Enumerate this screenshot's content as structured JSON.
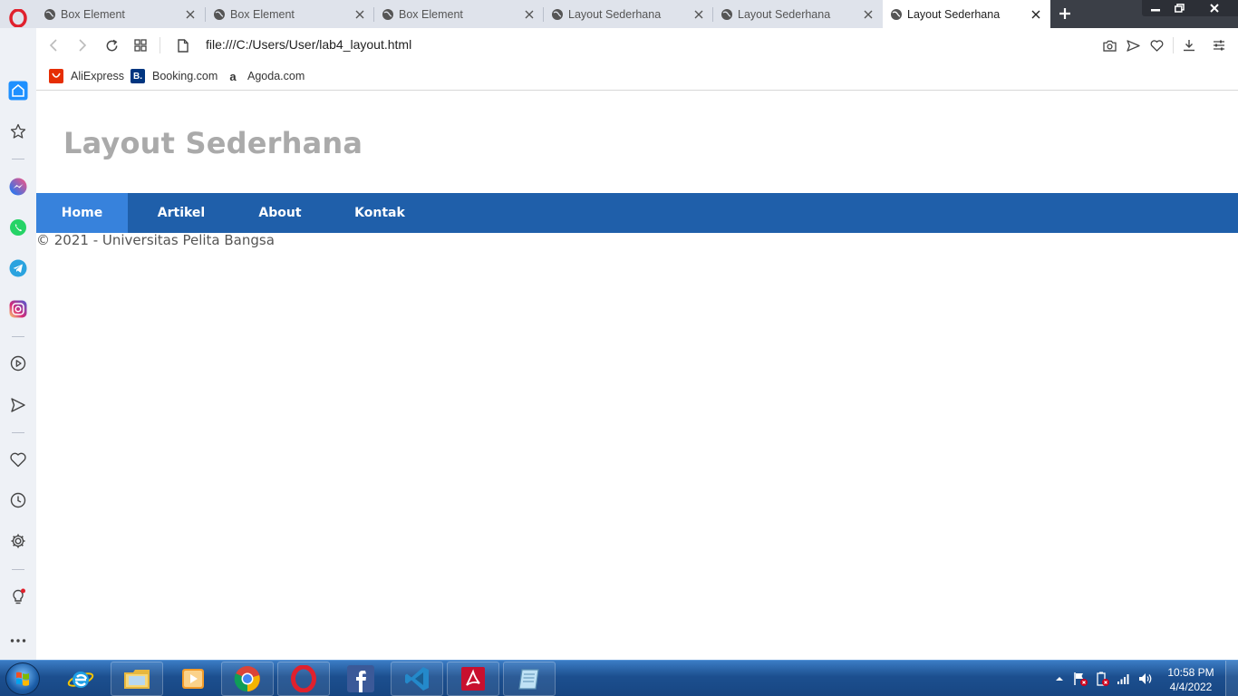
{
  "browser": {
    "tabs": [
      {
        "title": "Box Element",
        "active": false
      },
      {
        "title": "Box Element",
        "active": false
      },
      {
        "title": "Box Element",
        "active": false
      },
      {
        "title": "Layout Sederhana",
        "active": false
      },
      {
        "title": "Layout Sederhana",
        "active": false
      },
      {
        "title": "Layout Sederhana",
        "active": true
      }
    ],
    "url": "file:///C:/Users/User/lab4_layout.html",
    "bookmarks": [
      {
        "label": "AliExpress",
        "icon": "aliexpress-icon",
        "color": "#e62e04"
      },
      {
        "label": "Booking.com",
        "icon": "booking-icon",
        "color": "#003580",
        "glyph": "B."
      },
      {
        "label": "Agoda.com",
        "icon": "agoda-icon",
        "color": "#ffffff",
        "glyph": "a"
      }
    ],
    "sidebar_icons": [
      "home-icon",
      "bookmarks-icon",
      "messenger-icon",
      "whatsapp-icon",
      "telegram-icon",
      "instagram-icon",
      "player-icon",
      "send-icon",
      "heart-icon",
      "history-icon",
      "settings-icon",
      "tips-icon",
      "more-icon"
    ]
  },
  "page": {
    "site_title": "Layout Sederhana",
    "nav": [
      {
        "label": "Home",
        "active": true
      },
      {
        "label": "Artikel",
        "active": false
      },
      {
        "label": "About",
        "active": false
      },
      {
        "label": "Kontak",
        "active": false
      }
    ],
    "footer": "© 2021 - Universitas Pelita Bangsa",
    "colors": {
      "navbar": "#1f5faa",
      "nav_active": "#3782dc",
      "title": "#aaaaaa"
    }
  },
  "taskbar": {
    "apps": [
      "internet-explorer-icon",
      "file-explorer-icon",
      "media-player-icon",
      "chrome-icon",
      "opera-icon",
      "facebook-icon",
      "vscode-icon",
      "acrobat-icon",
      "notepad-icon"
    ],
    "time": "10:58 PM",
    "date": "4/4/2022"
  }
}
